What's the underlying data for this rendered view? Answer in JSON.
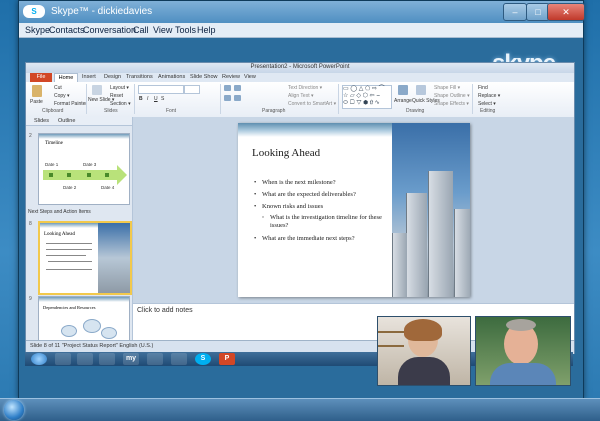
{
  "skype": {
    "title": "Skype™ - dickiedavies",
    "logo_text": "S",
    "watermark": "skype",
    "window_buttons": {
      "minimize": "–",
      "maximize": "□",
      "close": "✕"
    },
    "menu": [
      "Skype",
      "Contacts",
      "Conversation",
      "Call",
      "View",
      "Tools",
      "Help"
    ]
  },
  "powerpoint": {
    "title": "Presentation2 - Microsoft PowerPoint",
    "tabs": [
      "File",
      "Home",
      "Insert",
      "Design",
      "Transitions",
      "Animations",
      "Slide Show",
      "Review",
      "View"
    ],
    "ribbon": {
      "clipboard": {
        "label": "Clipboard",
        "paste": "Paste",
        "cut": "Cut",
        "copy": "Copy ▾",
        "format_painter": "Format Painter"
      },
      "slides": {
        "label": "Slides",
        "new_slide": "New Slide ▾",
        "layout": "Layout ▾",
        "reset": "Reset",
        "section": "Section ▾"
      },
      "font": {
        "label": "Font",
        "bold": "B",
        "italic": "I",
        "underline": "U",
        "strike": "S"
      },
      "paragraph": {
        "label": "Paragraph",
        "text_direction": "Text Direction ▾",
        "align_text": "Align Text ▾",
        "smartart": "Convert to SmartArt ▾"
      },
      "drawing": {
        "label": "Drawing",
        "arrange": "Arrange",
        "quick_styles": "Quick Styles",
        "shape_fill": "Shape Fill ▾",
        "shape_outline": "Shape Outline ▾",
        "shape_effects": "Shape Effects ▾"
      },
      "editing": {
        "label": "Editing",
        "find": "Find",
        "replace": "Replace ▾",
        "select": "Select ▾"
      }
    },
    "slides_pane": {
      "tabs": [
        "Slides",
        "Outline"
      ],
      "slide2": {
        "num": "2",
        "title": "Timeline",
        "dates": [
          "Date 1",
          "Date 2",
          "Date 3",
          "Date 4"
        ]
      },
      "section": "Next Steps and Action Items",
      "slide8": {
        "num": "8",
        "title": "Looking Ahead"
      },
      "slide9": {
        "num": "9",
        "title": "Dependencies and Resources"
      }
    },
    "slide": {
      "title": "Looking Ahead",
      "bullets": [
        "When is the next milestone?",
        "What are the expected deliverables?",
        "Known risks and issues",
        "What is the investigation timeline for these issues?",
        "What are the immediate next steps?"
      ]
    },
    "notes_placeholder": "Click to add notes",
    "status": "Slide 8 of 11   \"Project Status Report\"   English (U.S.)"
  },
  "shared_taskbar": [
    "",
    "",
    "",
    "",
    "my",
    "",
    "",
    "S",
    "P"
  ]
}
